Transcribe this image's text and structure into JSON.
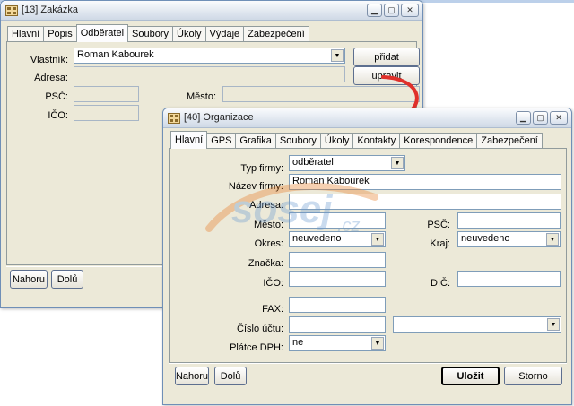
{
  "back_window": {
    "title": "[13] Zakázka",
    "tabs": [
      "Hlavní",
      "Popis",
      "Odběratel",
      "Soubory",
      "Úkoly",
      "Výdaje",
      "Zabezpečení"
    ],
    "labels": {
      "owner": "Vlastník:",
      "address": "Adresa:",
      "zip": "PSČ:",
      "city": "Město:",
      "ico": "IČO:"
    },
    "owner_value": "Roman Kabourek",
    "buttons": {
      "add": "přidat",
      "edit": "upravit",
      "up": "Nahoru",
      "down": "Dolů"
    }
  },
  "front_window": {
    "title": "[40] Organizace",
    "tabs": [
      "Hlavní",
      "GPS",
      "Grafika",
      "Soubory",
      "Úkoly",
      "Kontakty",
      "Korespondence",
      "Zabezpečení"
    ],
    "labels": {
      "company_type": "Typ firmy:",
      "company_name": "Název firmy:",
      "address": "Adresa:",
      "city": "Město:",
      "zip": "PSČ:",
      "district": "Okres:",
      "region": "Kraj:",
      "brand": "Značka:",
      "ico": "IČO:",
      "dic": "DIČ:",
      "fax": "FAX:",
      "account": "Číslo účtu:",
      "vat": "Plátce DPH:"
    },
    "values": {
      "company_type": "odběratel",
      "company_name": "Roman Kabourek",
      "district": "neuvedeno",
      "region": "neuvedeno",
      "vat": "ne"
    },
    "buttons": {
      "up": "Nahoru",
      "down": "Dolů",
      "save": "Uložit",
      "cancel": "Storno"
    }
  },
  "watermark": {
    "text": "sosej",
    "domain": ".cz"
  },
  "colors": {
    "arrow": "#e0302a",
    "title_bar": "#dfe6ef",
    "window_bg": "#ece9d8"
  },
  "icons": [
    "window-icon",
    "minimize-icon",
    "maximize-icon",
    "close-icon",
    "dropdown-arrow-icon"
  ]
}
